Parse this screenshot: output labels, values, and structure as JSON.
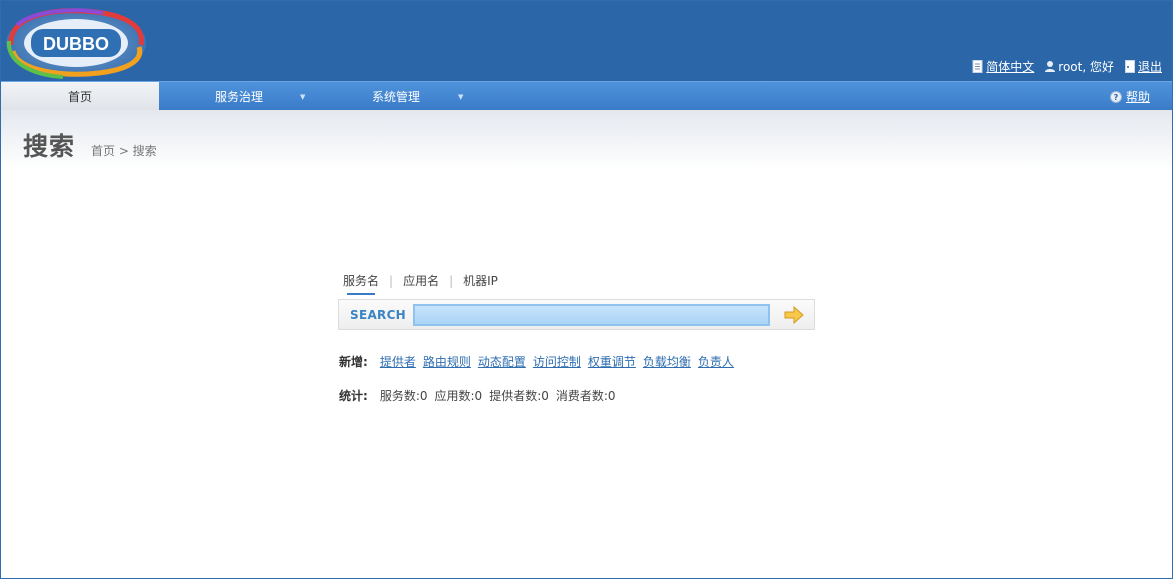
{
  "logo": {
    "text": "DUBBO"
  },
  "header": {
    "links": [
      {
        "icon": "document-icon",
        "label": "简体中文"
      },
      {
        "icon": "user-icon",
        "label": "root, 您好"
      },
      {
        "icon": "door-exit-icon",
        "label": "退出"
      }
    ]
  },
  "nav": {
    "items": [
      {
        "label": "首页",
        "active": true,
        "dropdown": false
      },
      {
        "label": "服务治理",
        "active": false,
        "dropdown": true
      },
      {
        "label": "系统管理",
        "active": false,
        "dropdown": true
      }
    ],
    "help": {
      "icon": "help-circle-icon",
      "label": "帮助"
    },
    "dropdown_arrow": "▼"
  },
  "page": {
    "title": "搜索",
    "breadcrumb": "首页 > 搜索"
  },
  "search": {
    "tabs": [
      "服务名",
      "应用名",
      "机器IP"
    ],
    "separator": "|",
    "label": "SEARCH",
    "value": ""
  },
  "add": {
    "label": "新增:",
    "links": [
      "提供者",
      "路由规则",
      "动态配置",
      "访问控制",
      "权重调节",
      "负载均衡",
      "负责人"
    ]
  },
  "stats": {
    "label": "统计:",
    "items": [
      "服务数:0",
      "应用数:0",
      "提供者数:0",
      "消费者数:0"
    ]
  },
  "colors": {
    "header_bg": "#2a66a8",
    "nav_bg": "#3a7bc8",
    "link": "#2d6db0",
    "search_label": "#3b84c4"
  }
}
